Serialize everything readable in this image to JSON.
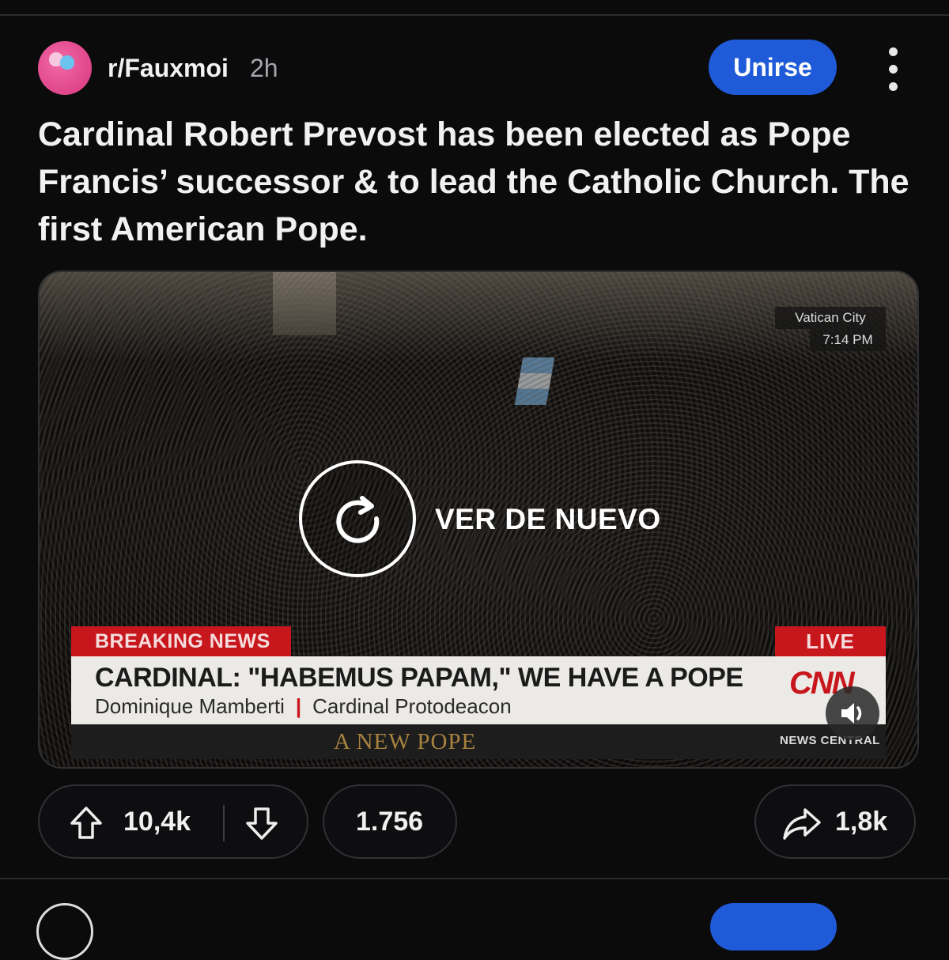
{
  "post": {
    "subreddit": "r/Fauxmoi",
    "age": "2h",
    "join_label": "Unirse",
    "title": "Cardinal Robert Prevost has been elected as Pope Francis’ successor & to lead the Catholic Church. The first American Pope."
  },
  "video": {
    "replay_label": "VER DE NUEVO",
    "location": "Vatican City",
    "local_time": "7:14 PM",
    "breaking_label": "BREAKING NEWS",
    "live_label": "LIVE",
    "headline": "CARDINAL: \"HABEMUS PAPAM,\" WE HAVE A POPE",
    "speaker": "Dominique Mamberti",
    "separator": "|",
    "speaker_role": "Cardinal Protodeacon",
    "network": "CNN",
    "ticker": "A NEW POPE",
    "channel": "NEWS CENTRAL"
  },
  "actions": {
    "upvotes": "10,4k",
    "comments": "1.756",
    "shares": "1,8k"
  },
  "colors": {
    "join_button": "#1f5bd9",
    "breaking_red": "#c8161d",
    "background": "#0b0b0c"
  }
}
